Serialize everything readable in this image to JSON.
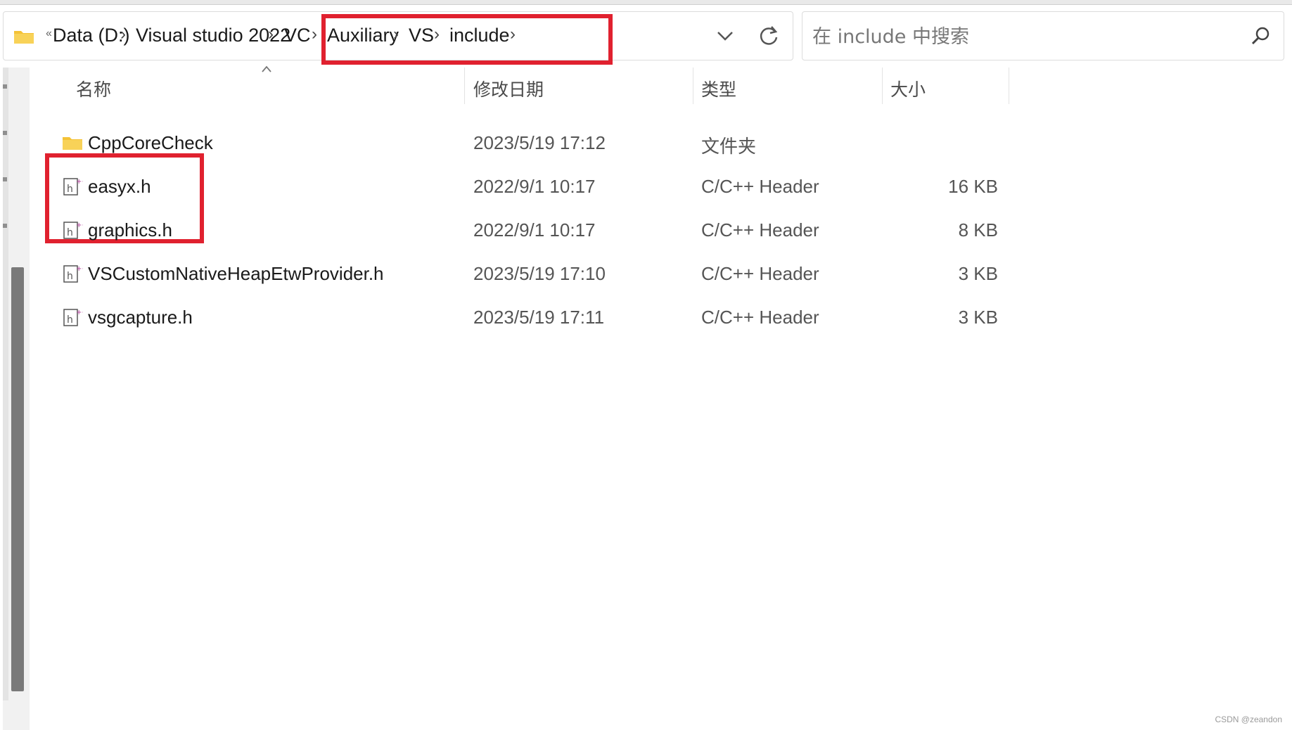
{
  "breadcrumb": {
    "overflow": "«",
    "items": [
      "Data (D:)",
      "Visual studio 2022",
      "VC",
      "Auxiliary",
      "VS",
      "include"
    ]
  },
  "search": {
    "placeholder": "在 include 中搜索"
  },
  "columns": {
    "name": "名称",
    "modified": "修改日期",
    "type": "类型",
    "size": "大小"
  },
  "files": [
    {
      "name": "CppCoreCheck",
      "modified": "2023/5/19 17:12",
      "type": "文件夹",
      "size": "",
      "icon": "folder-icon"
    },
    {
      "name": "easyx.h",
      "modified": "2022/9/1 10:17",
      "type": "C/C++ Header",
      "size": "16 KB",
      "icon": "header-file-icon"
    },
    {
      "name": "graphics.h",
      "modified": "2022/9/1 10:17",
      "type": "C/C++ Header",
      "size": "8 KB",
      "icon": "header-file-icon"
    },
    {
      "name": "VSCustomNativeHeapEtwProvider.h",
      "modified": "2023/5/19 17:10",
      "type": "C/C++ Header",
      "size": "3 KB",
      "icon": "header-file-icon"
    },
    {
      "name": "vsgcapture.h",
      "modified": "2023/5/19 17:11",
      "type": "C/C++ Header",
      "size": "3 KB",
      "icon": "header-file-icon"
    }
  ],
  "watermark": "CSDN @zeandon",
  "colors": {
    "highlight": "#e0212f",
    "folder": "#f4c237",
    "header_icon_accent": "#b0409a"
  }
}
